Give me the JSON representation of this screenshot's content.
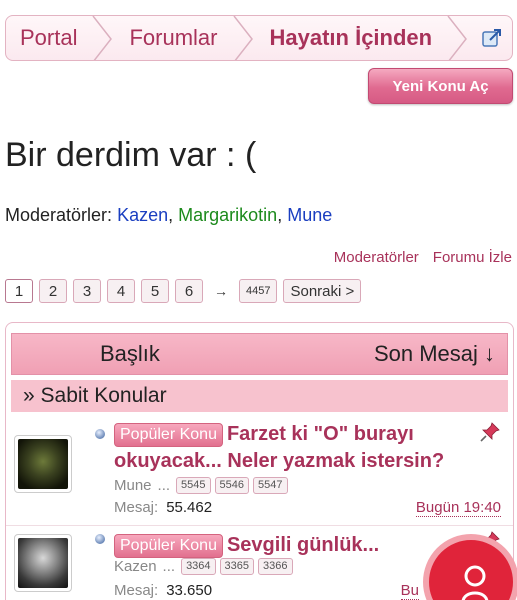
{
  "breadcrumb": {
    "items": [
      "Portal",
      "Forumlar",
      "Hayatın İçinden"
    ],
    "external_icon": "external-link-icon"
  },
  "actions": {
    "new_topic": "Yeni Konu Aç"
  },
  "page_title": "Bir derdim var : (",
  "moderators": {
    "label": "Moderatörler:",
    "names": [
      "Kazen",
      "Margarikotin",
      "Mune"
    ],
    "sep1": ",",
    "sep2": ","
  },
  "forum_links": {
    "moderators": "Moderatörler",
    "watch": "Forumu İzle"
  },
  "pagination": {
    "pages": [
      "1",
      "2",
      "3",
      "4",
      "5",
      "6"
    ],
    "arrow": "→",
    "last": "4457",
    "next": "Sonraki >",
    "current": 1
  },
  "table": {
    "col_title": "Başlık",
    "col_last": "Son Mesaj ↓",
    "sticky_label": "» Sabit Konular"
  },
  "topics": [
    {
      "badge": "Popüler Konu",
      "title": "Farzet ki \"O\" burayı okuyacak... Neler yazmak istersin?",
      "author": "Mune",
      "dots": "...",
      "pages": [
        "5545",
        "5546",
        "5547"
      ],
      "msg_label": "Mesaj:",
      "msg_count": "55.462",
      "last_date": "Bugün 19:40",
      "pinned": true
    },
    {
      "badge": "Popüler Konu",
      "title": "Sevgili günlük...",
      "author": "Kazen",
      "dots": "...",
      "pages": [
        "3364",
        "3365",
        "3366"
      ],
      "msg_label": "Mesaj:",
      "msg_count": "33.650",
      "last_date": "Bu",
      "pinned": true
    }
  ],
  "colors": {
    "accent": "#a8325a",
    "header_pink": "#f7b7c7",
    "fab_red": "#e0243a"
  }
}
